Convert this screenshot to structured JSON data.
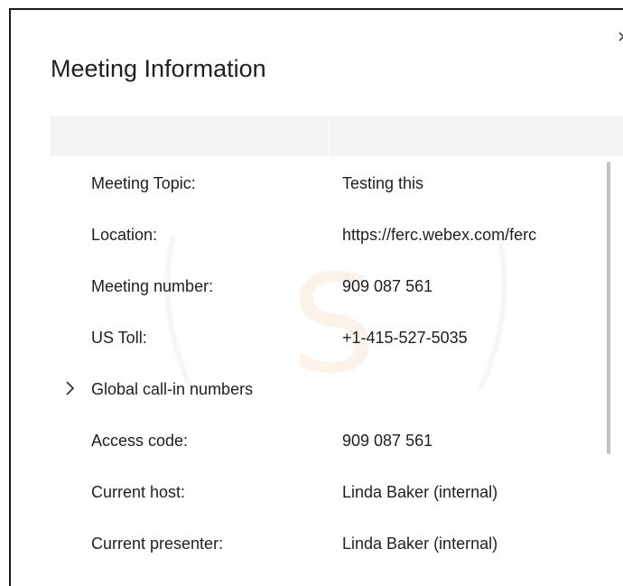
{
  "dialog": {
    "title": "Meeting Information",
    "close_glyph": "×"
  },
  "rows": [
    {
      "label": "Meeting Topic:",
      "value": "Testing this"
    },
    {
      "label": "Location:",
      "value": "https://ferc.webex.com/ferc"
    },
    {
      "label": "Meeting number:",
      "value": "909 087 561"
    },
    {
      "label": "US Toll:",
      "value": "+1-415-527-5035"
    },
    {
      "label": "Global call-in numbers",
      "value": "",
      "expandable": true,
      "expanded": false
    },
    {
      "label": "Access code:",
      "value": "909 087 561"
    },
    {
      "label": "Current host:",
      "value": "Linda Baker (internal)"
    },
    {
      "label": "Current presenter:",
      "value": "Linda Baker (internal)"
    }
  ],
  "icons": {
    "close": "close-icon",
    "expander": "chevron-right-icon"
  },
  "colors": {
    "text": "#1f1f1f",
    "header_band": "#f3f3f3",
    "scrollbar_thumb": "#c1c1c1",
    "border": "#1a1a1a"
  }
}
